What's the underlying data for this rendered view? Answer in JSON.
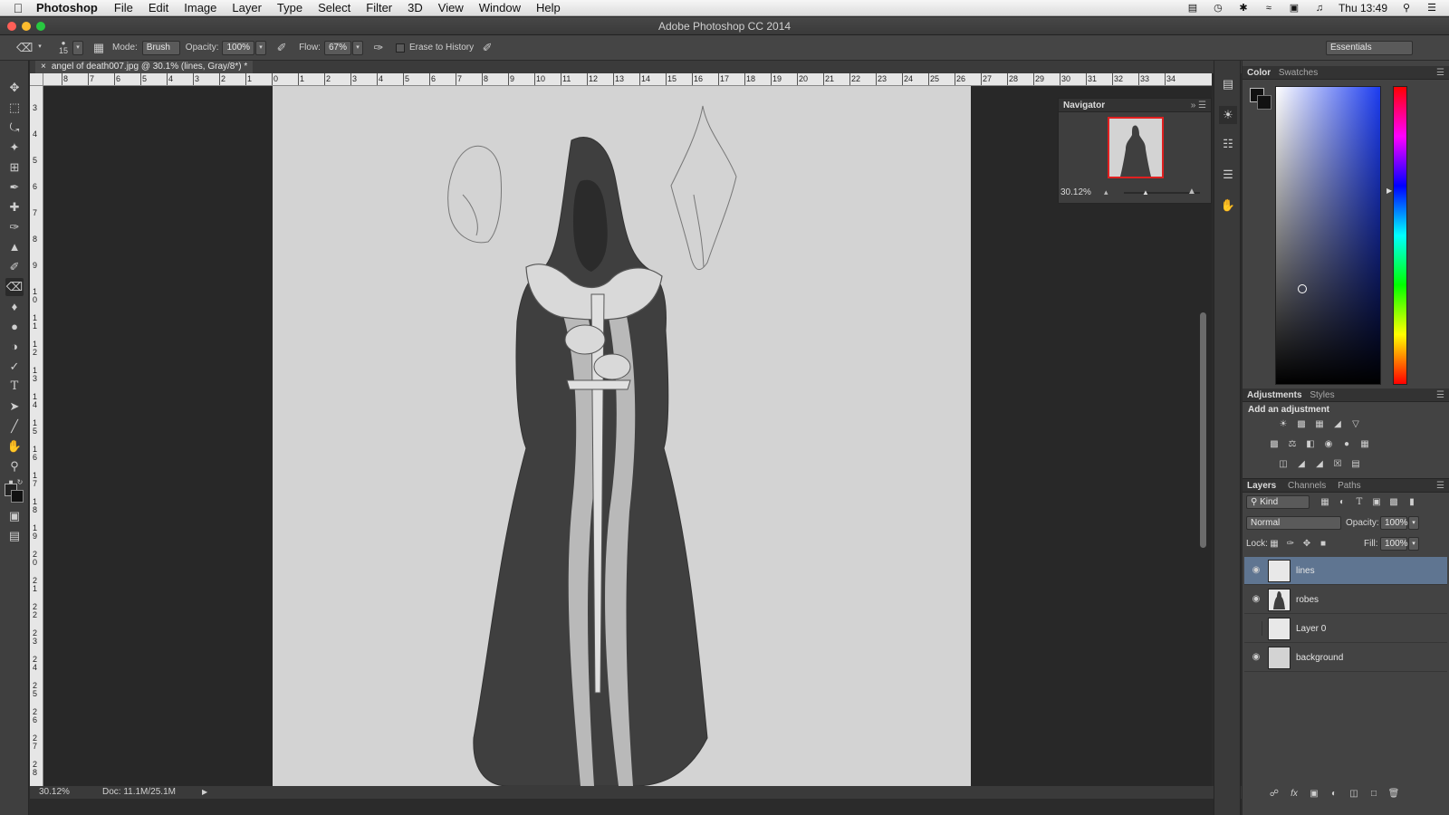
{
  "menubar": {
    "app_name": "Photoshop",
    "items": [
      "File",
      "Edit",
      "Image",
      "Layer",
      "Type",
      "Select",
      "Filter",
      "3D",
      "View",
      "Window",
      "Help"
    ],
    "clock": "Thu 13:49"
  },
  "window": {
    "title": "Adobe Photoshop CC 2014"
  },
  "options_bar": {
    "brush_size": "15",
    "mode_label": "Mode:",
    "mode_value": "Brush",
    "opacity_label": "Opacity:",
    "opacity_value": "100%",
    "flow_label": "Flow:",
    "flow_value": "67%",
    "erase_to_history": "Erase to History",
    "workspace": "Essentials"
  },
  "document": {
    "tab_title": "angel of death007.jpg @ 30.1% (lines, Gray/8*) *",
    "zoom": "30.12%",
    "doc_size": "Doc: 11.1M/25.1M",
    "ruler_h_labels": [
      "8",
      "7",
      "6",
      "5",
      "4",
      "3",
      "2",
      "1",
      "0",
      "1",
      "2",
      "3",
      "4",
      "5",
      "6",
      "7",
      "8",
      "9",
      "10",
      "11",
      "12",
      "13",
      "14",
      "15",
      "16",
      "17",
      "18",
      "19",
      "20",
      "21",
      "22",
      "23",
      "24",
      "25",
      "26",
      "27",
      "28",
      "29",
      "30",
      "31",
      "32",
      "33",
      "34"
    ],
    "ruler_v_labels": [
      "3",
      "4",
      "5",
      "6",
      "7",
      "8",
      "9",
      "10",
      "11",
      "12",
      "13",
      "14",
      "15",
      "16",
      "17",
      "18",
      "19",
      "20",
      "21",
      "22",
      "23",
      "24",
      "25",
      "26",
      "27",
      "28"
    ]
  },
  "navigator": {
    "title": "Navigator",
    "zoom": "30.12%"
  },
  "color_panel": {
    "tab_color": "Color",
    "tab_swatches": "Swatches"
  },
  "adjustments_panel": {
    "tab_adjustments": "Adjustments",
    "tab_styles": "Styles",
    "heading": "Add an adjustment"
  },
  "layers_panel": {
    "tab_layers": "Layers",
    "tab_channels": "Channels",
    "tab_paths": "Paths",
    "filter_kind": "Kind",
    "blend_mode": "Normal",
    "opacity_label": "Opacity:",
    "opacity_value": "100%",
    "lock_label": "Lock:",
    "fill_label": "Fill:",
    "fill_value": "100%",
    "layers": [
      {
        "name": "lines",
        "visible": true,
        "selected": true
      },
      {
        "name": "robes",
        "visible": true,
        "selected": false
      },
      {
        "name": "Layer 0",
        "visible": false,
        "selected": false
      },
      {
        "name": "background",
        "visible": true,
        "selected": false
      }
    ]
  },
  "colors": {
    "selected_layer": "#5f7591",
    "canvas": "#d3d3d3",
    "robe": "#3f3f3f"
  }
}
